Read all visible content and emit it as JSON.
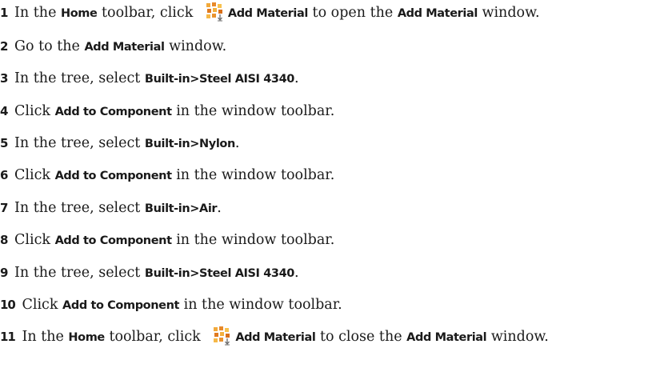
{
  "icons": {
    "add_material": "add-material-icon"
  },
  "steps": [
    {
      "num": "1",
      "parts": [
        "In the ",
        "Home",
        " toolbar, click ",
        "Add Material",
        " to open the ",
        "Add Material",
        " window."
      ]
    },
    {
      "num": "2",
      "parts": [
        "Go to the ",
        "Add Material",
        " window."
      ]
    },
    {
      "num": "3",
      "parts": [
        "In the tree, select ",
        "Built-in>Steel AISI 4340",
        "."
      ]
    },
    {
      "num": "4",
      "parts": [
        "Click ",
        "Add to Component",
        " in the window toolbar."
      ]
    },
    {
      "num": "5",
      "parts": [
        "In the tree, select ",
        "Built-in>Nylon",
        "."
      ]
    },
    {
      "num": "6",
      "parts": [
        "Click ",
        "Add to Component",
        " in the window toolbar."
      ]
    },
    {
      "num": "7",
      "parts": [
        "In the tree, select ",
        "Built-in>Air",
        "."
      ]
    },
    {
      "num": "8",
      "parts": [
        "Click ",
        "Add to Component",
        " in the window toolbar."
      ]
    },
    {
      "num": "9",
      "parts": [
        "In the tree, select ",
        "Built-in>Steel AISI 4340",
        "."
      ]
    },
    {
      "num": "10",
      "parts": [
        "Click ",
        "Add to Component",
        " in the window toolbar."
      ]
    },
    {
      "num": "11",
      "parts": [
        "In the ",
        "Home",
        " toolbar, click ",
        "Add Material",
        " to close the ",
        "Add Material",
        " window."
      ]
    }
  ]
}
